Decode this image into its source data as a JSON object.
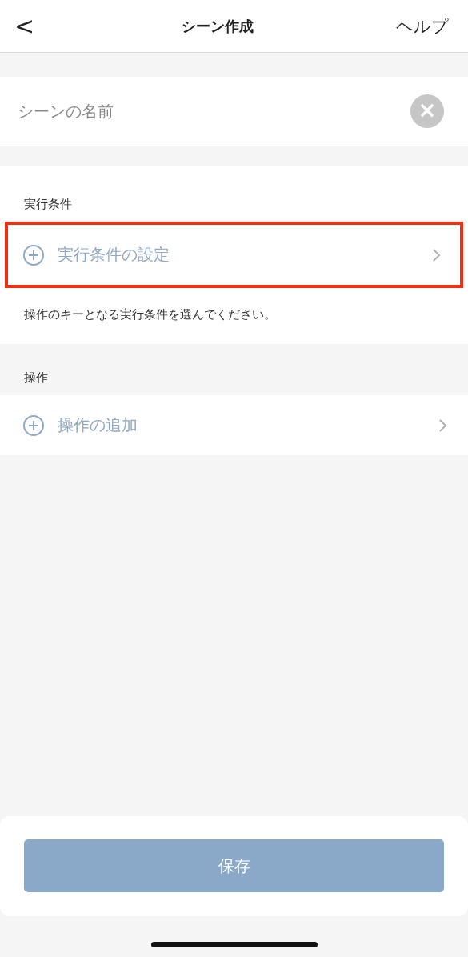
{
  "header": {
    "back": "<",
    "title": "シーン作成",
    "help": "ヘルプ"
  },
  "name_field": {
    "placeholder": "シーンの名前",
    "clear": "×"
  },
  "condition_section": {
    "label": "実行条件",
    "row": {
      "label": "実行条件の設定",
      "highlighted": true
    },
    "hint": "操作のキーとなる実行条件を選んでください。"
  },
  "action_section": {
    "label": "操作",
    "row": {
      "label": "操作の追加",
      "highlighted": false
    }
  },
  "save_button": "保存"
}
